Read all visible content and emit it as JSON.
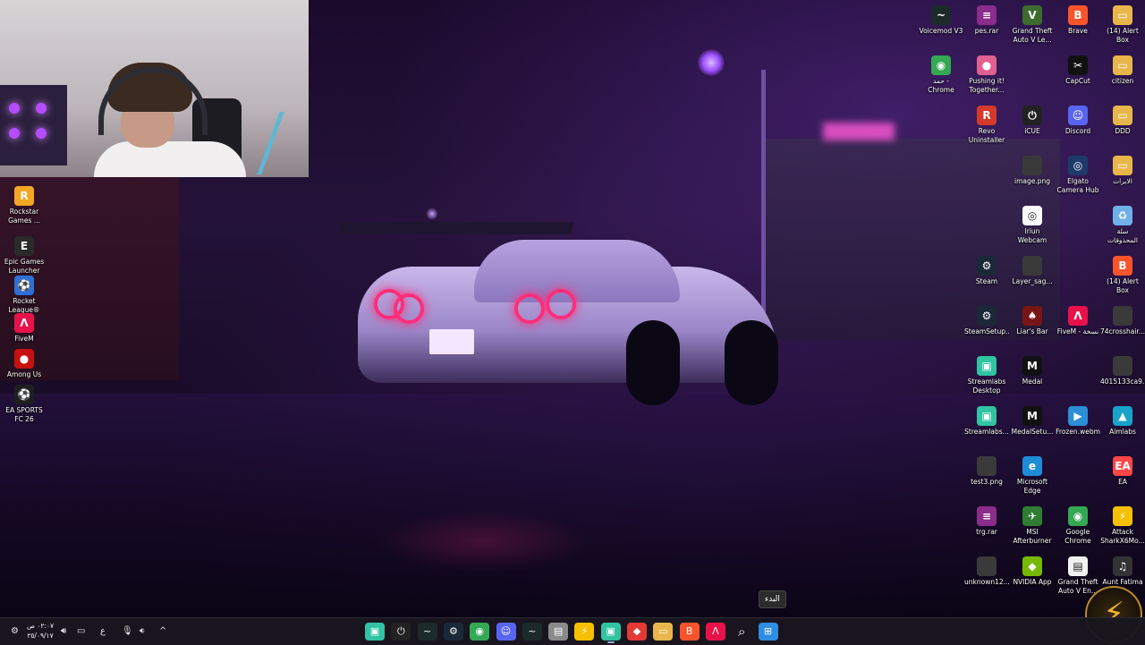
{
  "desktop": {
    "left_icons": [
      {
        "label": "Rockstar\nGames ...",
        "icon": "rockstar-icon",
        "color": "#f5a623",
        "glyph": "R"
      },
      {
        "label": "Epic Games\nLauncher",
        "icon": "epic-games-icon",
        "color": "#2a2a2a",
        "glyph": "E"
      },
      {
        "label": "Rocket\nLeague®",
        "icon": "rocket-league-icon",
        "color": "#2f6fd6",
        "glyph": "⚽"
      },
      {
        "label": "FiveM",
        "icon": "fivem-icon",
        "color": "#e8124a",
        "glyph": "Λ"
      },
      {
        "label": "Among Us",
        "icon": "among-us-icon",
        "color": "#c51111",
        "glyph": "●"
      },
      {
        "label": "EA SPORTS\nFC 26",
        "icon": "ea-sports-fc-icon",
        "color": "#1f1f1f",
        "glyph": "⚽"
      }
    ],
    "right_icons": [
      {
        "label": "Voicemod V3",
        "icon": "voicemod-icon",
        "color": "#1c2b2a",
        "glyph": "~"
      },
      {
        "label": "pes.rar",
        "icon": "winrar-icon",
        "color": "#8a2c8a",
        "glyph": "≡"
      },
      {
        "label": "Grand Theft\nAuto V Le...",
        "icon": "gta-icon",
        "color": "#3d6b2e",
        "glyph": "V"
      },
      {
        "label": "Brave",
        "icon": "brave-icon",
        "color": "#fb542b",
        "glyph": "B"
      },
      {
        "label": "(14) Alert Box\n_ Streamlab...",
        "icon": "folder-icon",
        "color": "#e8b64a",
        "glyph": "▭"
      },
      {
        "label": "حمد -\nChrome",
        "icon": "chrome-icon",
        "color": "#34a853",
        "glyph": "◉"
      },
      {
        "label": "Pushing it!\nTogether...",
        "icon": "pushing-it-icon",
        "color": "#e06090",
        "glyph": "●"
      },
      {
        "label": "CapCut",
        "icon": "capcut-icon",
        "color": "#111111",
        "glyph": "✂"
      },
      {
        "label": "citizen",
        "icon": "folder-icon",
        "color": "#e8b64a",
        "glyph": "▭"
      },
      {
        "label": "Revo\nUninstaller",
        "icon": "revo-icon",
        "color": "#d33a2c",
        "glyph": "R"
      },
      {
        "label": "iCUE",
        "icon": "icue-icon",
        "color": "#222222",
        "glyph": "⏻"
      },
      {
        "label": "Discord",
        "icon": "discord-icon",
        "color": "#5865f2",
        "glyph": "☺"
      },
      {
        "label": "DDD",
        "icon": "folder-icon",
        "color": "#e8b64a",
        "glyph": "▭"
      },
      {
        "label": "image.png",
        "icon": "image-file-icon",
        "color": "#3a3a3a",
        "glyph": ""
      },
      {
        "label": "Elgato\nCamera Hub",
        "icon": "elgato-icon",
        "color": "#1d3a6b",
        "glyph": "◎"
      },
      {
        "label": "الايرات",
        "icon": "folder-icon",
        "color": "#e8b64a",
        "glyph": "▭"
      },
      {
        "label": "Iriun\nWebcam",
        "icon": "iriun-icon",
        "color": "#ffffff",
        "glyph": "◎"
      },
      {
        "label": "سلة\nالمحذوفات",
        "icon": "recycle-bin-icon",
        "color": "#6fb0e8",
        "glyph": "♻"
      },
      {
        "label": "Steam",
        "icon": "steam-icon",
        "color": "#1b2838",
        "glyph": "⚙"
      },
      {
        "label": "Layer_sag...",
        "icon": "layer-file-icon",
        "color": "#3a3a3a",
        "glyph": ""
      },
      {
        "label": "(14) Alert Box\n_ Streamlab...",
        "icon": "brave-icon",
        "color": "#fb542b",
        "glyph": "B"
      },
      {
        "label": "SteamSetup...",
        "icon": "steam-setup-icon",
        "color": "#1b2838",
        "glyph": "⚙"
      },
      {
        "label": "Liar's Bar",
        "icon": "liars-bar-icon",
        "color": "#7a1515",
        "glyph": "♠"
      },
      {
        "label": "FiveM - نسخة",
        "icon": "fivem-icon",
        "color": "#e8124a",
        "glyph": "Λ"
      },
      {
        "label": "74crosshair...",
        "icon": "file-icon",
        "color": "#3a3a3a",
        "glyph": ""
      },
      {
        "label": "Streamlabs\nDesktop",
        "icon": "streamlabs-icon",
        "color": "#31c3a2",
        "glyph": "▣"
      },
      {
        "label": "Medal",
        "icon": "medal-icon",
        "color": "#111111",
        "glyph": "M"
      },
      {
        "label": "4015133ca9...",
        "icon": "file-icon",
        "color": "#3a3a3a",
        "glyph": ""
      },
      {
        "label": "Streamlabs...",
        "icon": "streamlabs-icon",
        "color": "#31c3a2",
        "glyph": "▣"
      },
      {
        "label": "MedalSetu...",
        "icon": "medal-setup-icon",
        "color": "#111111",
        "glyph": "M"
      },
      {
        "label": "Frozen.webm",
        "icon": "video-file-icon",
        "color": "#2a8fd6",
        "glyph": "▶"
      },
      {
        "label": "Aimlabs",
        "icon": "aimlabs-icon",
        "color": "#1aa3c8",
        "glyph": "▲"
      },
      {
        "label": "test3.png",
        "icon": "image-file-icon",
        "color": "#3a3a3a",
        "glyph": ""
      },
      {
        "label": "Microsoft\nEdge",
        "icon": "edge-icon",
        "color": "#1c8cd8",
        "glyph": "e"
      },
      {
        "label": "EA",
        "icon": "ea-icon",
        "color": "#ff4747",
        "glyph": "EA"
      },
      {
        "label": "trg.rar",
        "icon": "winrar-icon",
        "color": "#8a2c8a",
        "glyph": "≡"
      },
      {
        "label": "MSI\nAfterburner",
        "icon": "msi-afterburner-icon",
        "color": "#2e7d32",
        "glyph": "✈"
      },
      {
        "label": "Google\nChrome",
        "icon": "chrome-icon",
        "color": "#34a853",
        "glyph": "◉"
      },
      {
        "label": "Attack\nSharkX6Mo...",
        "icon": "attack-shark-icon",
        "color": "#f6c000",
        "glyph": "⚡"
      },
      {
        "label": "unknown12...",
        "icon": "file-icon",
        "color": "#3a3a3a",
        "glyph": ""
      },
      {
        "label": "NVIDIA App",
        "icon": "nvidia-icon",
        "color": "#76b900",
        "glyph": "◆"
      },
      {
        "label": "Grand Theft\nAuto V En...",
        "icon": "document-icon",
        "color": "#f2f2f2",
        "glyph": "▤"
      },
      {
        "label": "Aunt Fatima\nخالة ...",
        "icon": "aunt-fatima-icon",
        "color": "#333333",
        "glyph": "♫"
      }
    ]
  },
  "tooltip": {
    "text": "البدء"
  },
  "taskbar": {
    "apps": [
      {
        "name": "streamlabs-app",
        "icon": "streamlabs-icon",
        "color": "#31c3a2",
        "glyph": "▣"
      },
      {
        "name": "icue-app",
        "icon": "icue-icon",
        "color": "#222222",
        "glyph": "⏻"
      },
      {
        "name": "voicemod-app",
        "icon": "voicemod-icon",
        "color": "#1c2b2a",
        "glyph": "~"
      },
      {
        "name": "steam-app",
        "icon": "steam-icon",
        "color": "#1b2838",
        "glyph": "⚙"
      },
      {
        "name": "chrome-app",
        "icon": "chrome-icon",
        "color": "#34a853",
        "glyph": "◉"
      },
      {
        "name": "discord-app",
        "icon": "discord-icon",
        "color": "#5865f2",
        "glyph": "☺"
      },
      {
        "name": "voicemod-alt-app",
        "icon": "voicemod-icon",
        "color": "#1c2b2a",
        "glyph": "~"
      },
      {
        "name": "notepad-app",
        "icon": "notepad-icon",
        "color": "#8a8a8a",
        "glyph": "▤"
      },
      {
        "name": "attack-shark-app",
        "icon": "attack-shark-icon",
        "color": "#f6c000",
        "glyph": "⚡"
      },
      {
        "name": "streamlabs-active-app",
        "icon": "streamlabs-icon",
        "color": "#31c3a2",
        "glyph": "▣"
      },
      {
        "name": "red-app",
        "icon": "red-app-icon",
        "color": "#e53935",
        "glyph": "◆"
      },
      {
        "name": "file-explorer-app",
        "icon": "folder-icon",
        "color": "#e8b64a",
        "glyph": "▭"
      },
      {
        "name": "brave-app",
        "icon": "brave-icon",
        "color": "#fb542b",
        "glyph": "B"
      },
      {
        "name": "fivem-app",
        "icon": "fivem-icon",
        "color": "#e8124a",
        "glyph": "Λ"
      },
      {
        "name": "search-app",
        "icon": "search-icon",
        "color": "transparent",
        "glyph": "⌕"
      },
      {
        "name": "start-button",
        "icon": "windows-start-icon",
        "color": "#2f8de4",
        "glyph": "⊞"
      }
    ],
    "tray": {
      "clock_time": "٠٢:٠٧ ص",
      "clock_date": "٢٥/٠٩/١٧",
      "language": "ع",
      "chevron": "^"
    }
  }
}
